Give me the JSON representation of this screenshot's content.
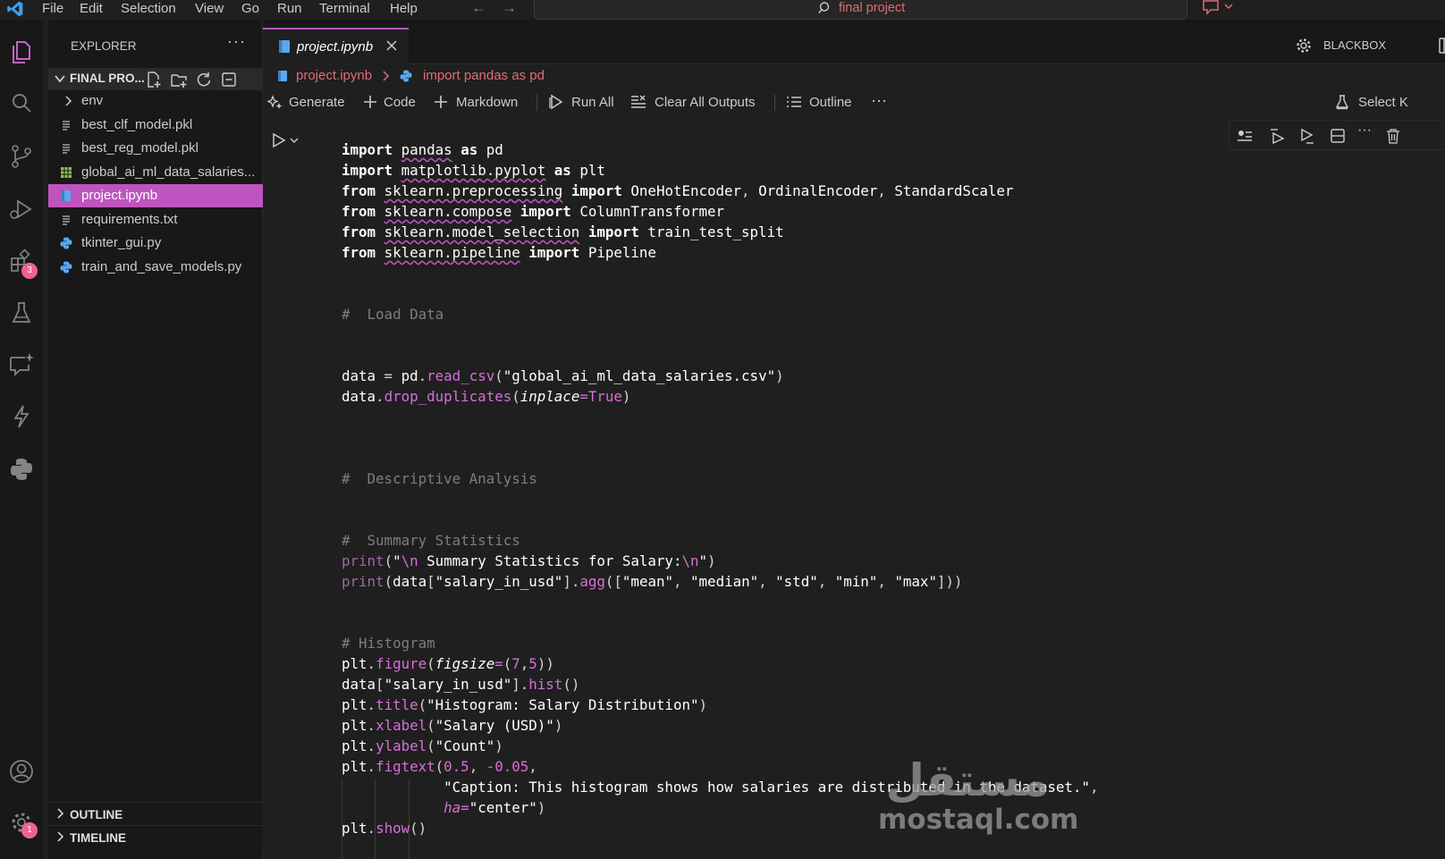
{
  "titlebar": {
    "menu": [
      "File",
      "Edit",
      "Selection",
      "View",
      "Go",
      "Run",
      "Terminal",
      "Help"
    ],
    "search_text": "final project"
  },
  "activity_bar": {
    "extensions_badge": "3",
    "manage_badge": "1"
  },
  "sidebar": {
    "title": "EXPLORER",
    "more": "···",
    "folder_name": "FINAL PRO...",
    "items": [
      {
        "label": "env",
        "icon": "chevron-right-icon"
      },
      {
        "label": "best_clf_model.pkl",
        "icon": "lines-file-icon"
      },
      {
        "label": "best_reg_model.pkl",
        "icon": "lines-file-icon"
      },
      {
        "label": "global_ai_ml_data_salaries...",
        "icon": "csv-table-icon"
      },
      {
        "label": "project.ipynb",
        "icon": "notebook-icon"
      },
      {
        "label": "requirements.txt",
        "icon": "lines-file-icon"
      },
      {
        "label": "tkinter_gui.py",
        "icon": "python-icon"
      },
      {
        "label": "train_and_save_models.py",
        "icon": "python-icon"
      }
    ],
    "outline_label": "OUTLINE",
    "timeline_label": "TIMELINE"
  },
  "editor": {
    "tab_label": "project.ipynb",
    "blackbox_label": "BLACKBOX",
    "breadcrumb": [
      "project.ipynb",
      "import pandas as pd"
    ],
    "toolbar": {
      "generate": "Generate",
      "code": "Code",
      "markdown": "Markdown",
      "run_all": "Run All",
      "clear_outputs": "Clear All Outputs",
      "outline": "Outline",
      "more": "···",
      "select_kernel": "Select K"
    }
  },
  "watermark": {
    "arabic": "مستقل",
    "latin": "mostaql.com"
  },
  "colors": {
    "accent": "#c054bf",
    "breadcrumb": "#e06c75",
    "background": "#1f1f1f"
  }
}
